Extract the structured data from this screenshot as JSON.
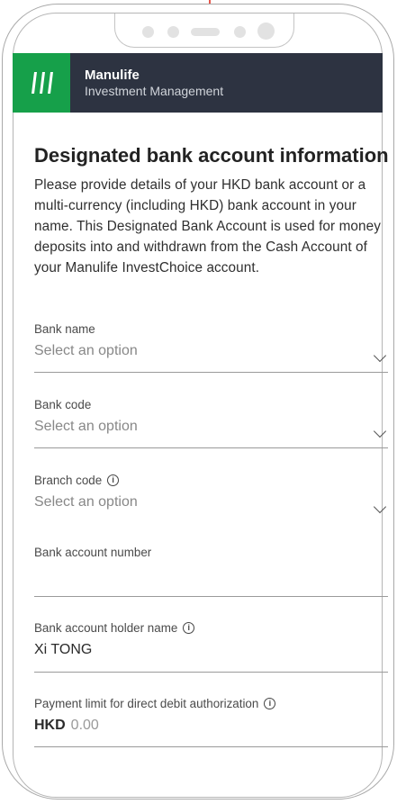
{
  "brand": {
    "name": "Manulife",
    "subtitle": "Investment Management"
  },
  "page": {
    "title": "Designated bank account information",
    "intro": "Please provide details of your HKD bank account or a multi-currency (including HKD) bank account in your name. This Designated Bank Account is used for money deposits into and withdrawn from the Cash Account of your Manulife InvestChoice account."
  },
  "fields": {
    "bank_name": {
      "label": "Bank name",
      "placeholder": "Select an option"
    },
    "bank_code": {
      "label": "Bank code",
      "placeholder": "Select an option"
    },
    "branch_code": {
      "label": "Branch code",
      "placeholder": "Select an option"
    },
    "account_number": {
      "label": "Bank account number",
      "value": ""
    },
    "holder_name": {
      "label": "Bank account holder name",
      "value": "Xi TONG"
    },
    "payment_limit": {
      "label": "Payment limit for direct debit authorization",
      "currency": "HKD",
      "value": "0.00"
    }
  },
  "icons": {
    "info": "info-icon",
    "chevron": "chevron-down-icon"
  },
  "colors": {
    "brand_green": "#16a04a",
    "brand_bar": "#2d3341",
    "pointer": "#e6564a"
  }
}
